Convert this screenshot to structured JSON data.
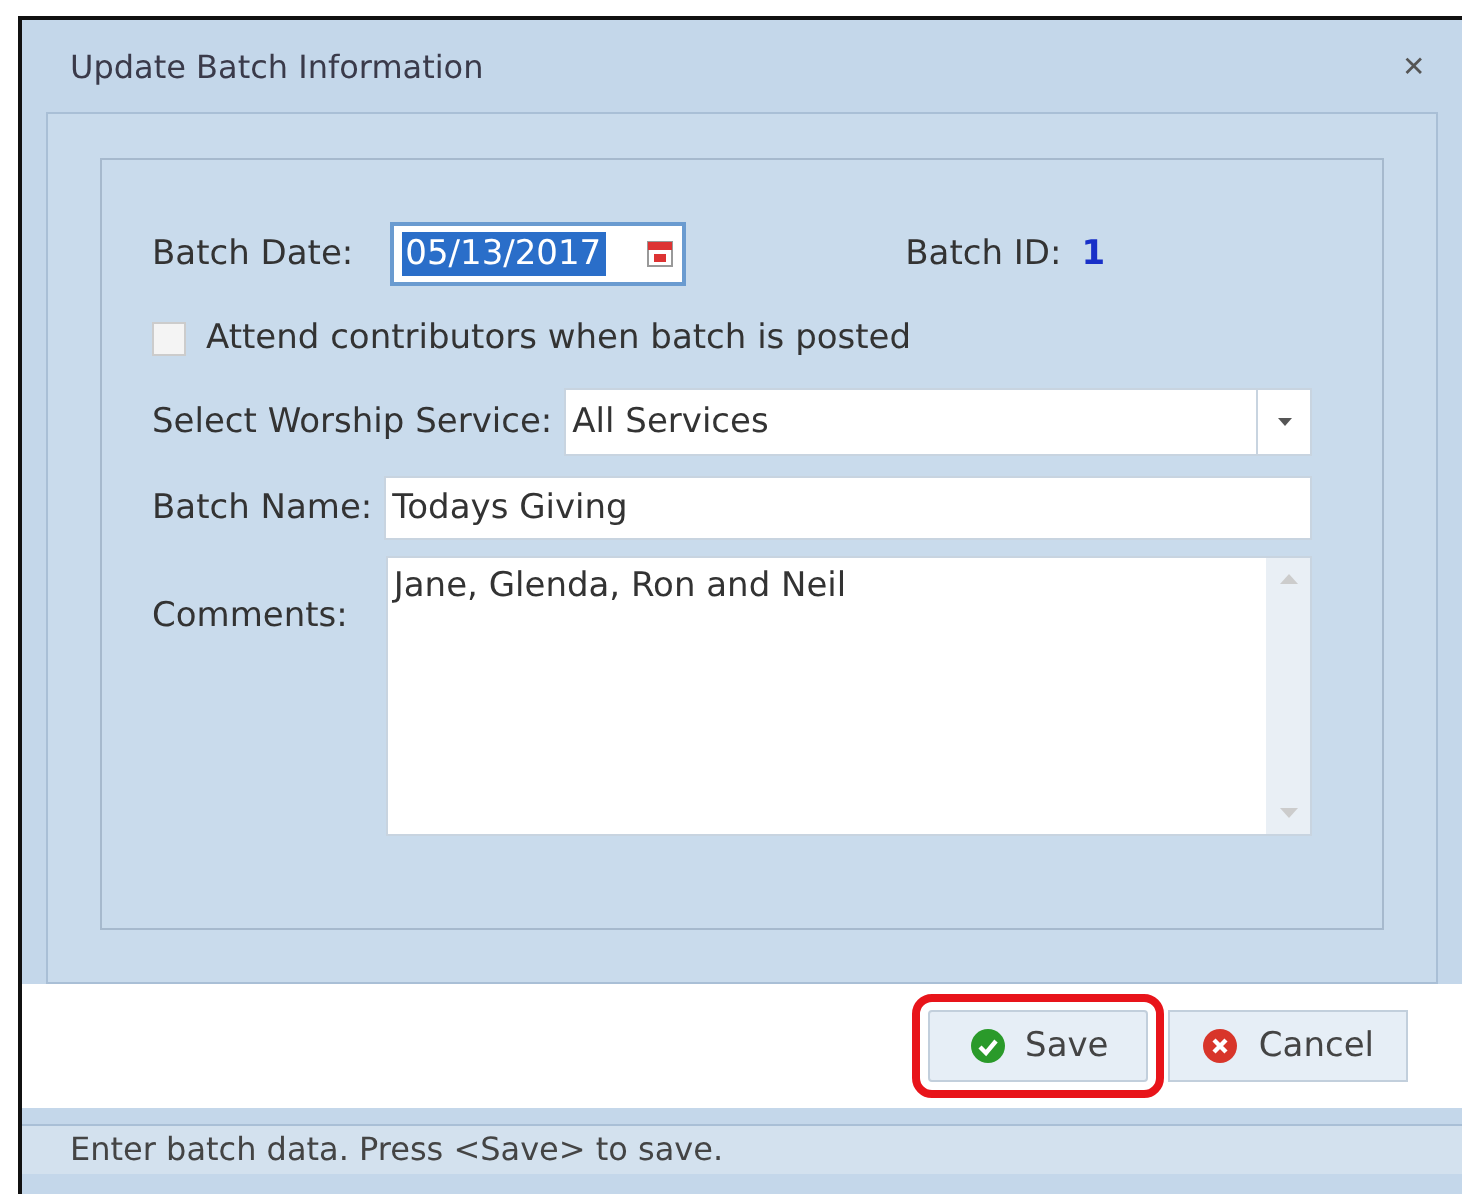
{
  "window": {
    "title": "Update Batch Information",
    "close": "✕"
  },
  "batch_date": {
    "label": "Batch Date:",
    "value": "05/13/2017",
    "selected": true
  },
  "batch_id": {
    "label": "Batch ID:",
    "value": "1"
  },
  "attend_checkbox": {
    "label": "Attend contributors when batch is posted",
    "checked": false
  },
  "worship_service": {
    "label": "Select Worship Service:",
    "value": "All Services"
  },
  "batch_name": {
    "label": "Batch Name:",
    "value": "Todays Giving"
  },
  "comments": {
    "label": "Comments:",
    "value": "Jane, Glenda, Ron and Neil"
  },
  "buttons": [
    {
      "kind": "save",
      "label": "Save",
      "highlighted": true
    },
    {
      "kind": "cancel",
      "label": "Cancel",
      "highlighted": false
    }
  ],
  "status_bar": "Enter batch data. Press <Save> to save."
}
